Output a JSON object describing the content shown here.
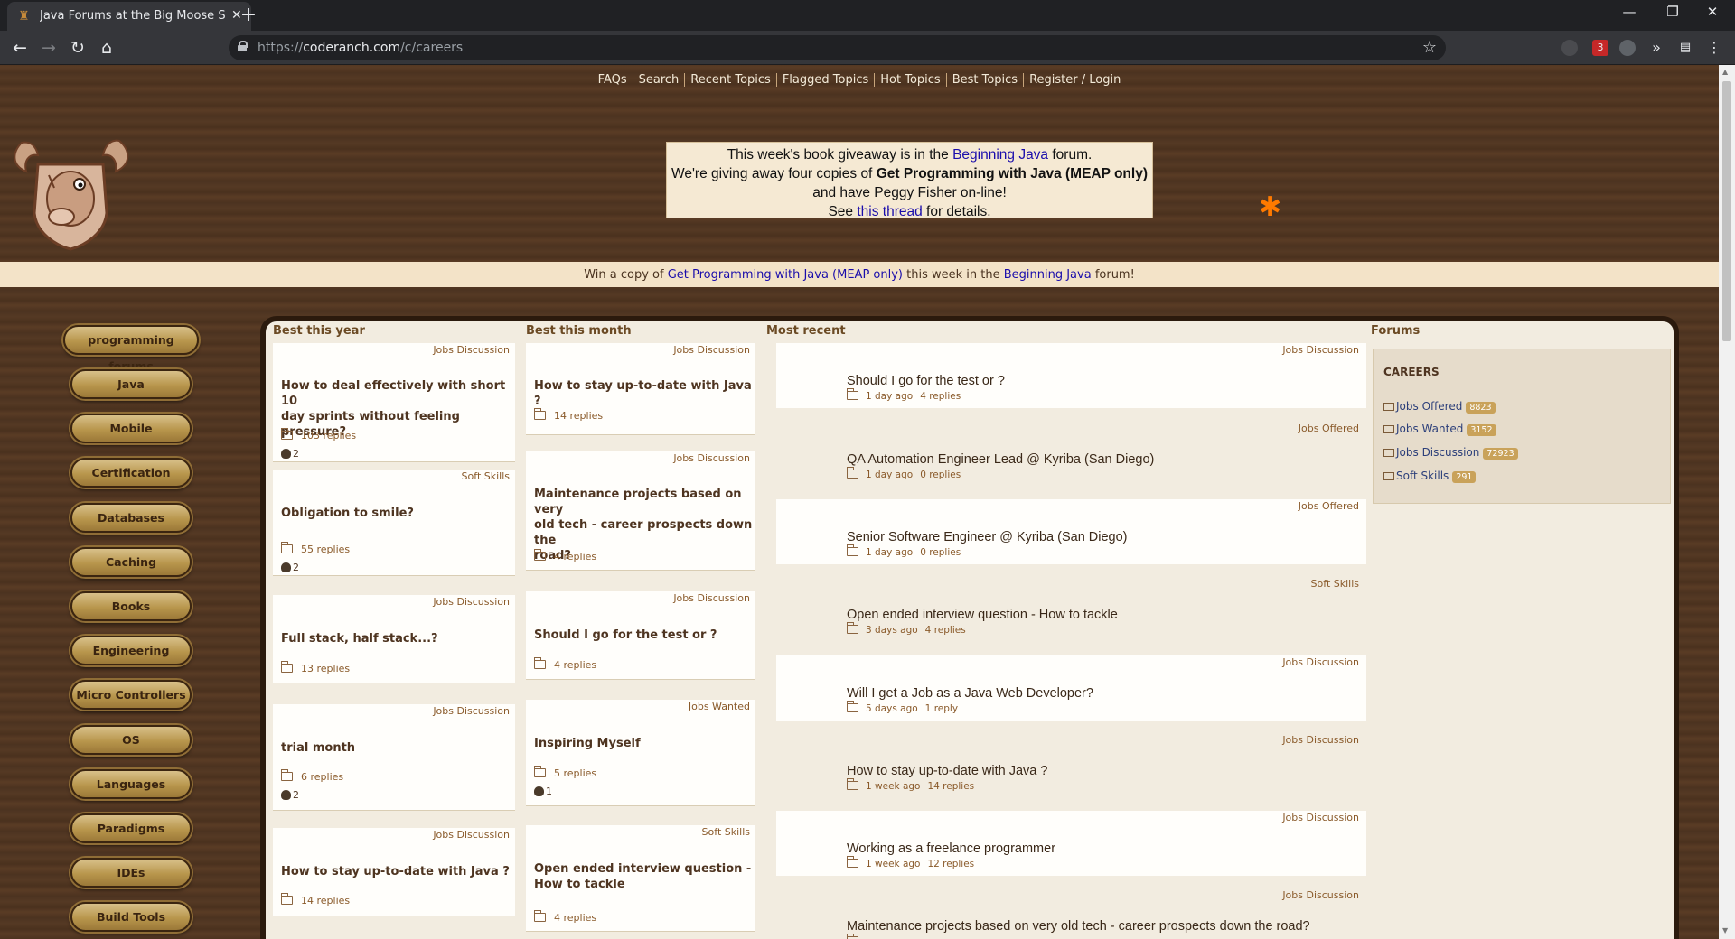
{
  "browser": {
    "tab_title": "Java Forums at the Big Moose Sal",
    "url_prefix": "https://",
    "url_host": "coderanch.com",
    "url_path": "/c/careers",
    "extension_badge": "3"
  },
  "topnav": [
    "FAQs",
    "Search",
    "Recent Topics",
    "Flagged Topics",
    "Hot Topics",
    "Best Topics",
    "Register / Login"
  ],
  "giveaway": {
    "line1_pre": "This week's book giveaway is in the ",
    "line1_link": "Beginning Java",
    "line1_post": " forum.",
    "line2_pre": "We're giving away four copies of ",
    "line2_bold": "Get Programming with Java (MEAP only)",
    "line2_post": " and have Peggy Fisher on-line!",
    "line3_pre": "See ",
    "line3_link": "this thread",
    "line3_post": " for details."
  },
  "winbar": {
    "pre": "Win a copy of ",
    "book": "Get Programming with Java (MEAP only)",
    "mid": " this week in the ",
    "forum": "Beginning Java",
    "post": " forum!"
  },
  "sidebar": [
    "programming forums",
    "Java",
    "Mobile",
    "Certification",
    "Databases",
    "Caching",
    "Books",
    "Engineering",
    "Micro Controllers",
    "OS",
    "Languages",
    "Paradigms",
    "IDEs",
    "Build Tools"
  ],
  "columns": {
    "best_year": "Best this year",
    "best_month": "Best this month",
    "most_recent": "Most recent",
    "forums": "Forums"
  },
  "best_year": [
    {
      "forum": "Jobs Discussion",
      "title_lines": [
        "How to deal effectively with short 10",
        "day sprints without feeling pressure?"
      ],
      "replies": "103 replies",
      "votes": "2"
    },
    {
      "forum": "Soft Skills",
      "title_lines": [
        "Obligation to smile?"
      ],
      "replies": "55 replies",
      "votes": "2"
    },
    {
      "forum": "Jobs Discussion",
      "title_lines": [
        "Full stack, half stack...?"
      ],
      "replies": "13 replies",
      "votes": ""
    },
    {
      "forum": "Jobs Discussion",
      "title_lines": [
        "trial month"
      ],
      "replies": "6 replies",
      "votes": "2"
    },
    {
      "forum": "Jobs Discussion",
      "title_lines": [
        "How to stay up-to-date with Java ?"
      ],
      "replies": "14 replies",
      "votes": ""
    }
  ],
  "best_month": [
    {
      "forum": "Jobs Discussion",
      "title_lines": [
        "How to stay up-to-date with Java ?"
      ],
      "replies": "14 replies",
      "votes": ""
    },
    {
      "forum": "Jobs Discussion",
      "title_lines": [
        "Maintenance projects based on very",
        "old tech - career prospects down the",
        "road?"
      ],
      "replies": "4 replies",
      "votes": ""
    },
    {
      "forum": "Jobs Discussion",
      "title_lines": [
        "Should I go for the test or ?"
      ],
      "replies": "4 replies",
      "votes": ""
    },
    {
      "forum": "Jobs Wanted",
      "title_lines": [
        "Inspiring Myself"
      ],
      "replies": "5 replies",
      "votes": "1"
    },
    {
      "forum": "Soft Skills",
      "title_lines": [
        "Open ended interview question -",
        "How to tackle"
      ],
      "replies": "4 replies",
      "votes": ""
    }
  ],
  "most_recent": [
    {
      "forum": "Jobs Discussion",
      "title": "Should I go for the test or ?",
      "age": "1 day ago",
      "replies": "4 replies"
    },
    {
      "forum": "Jobs Offered",
      "title": "QA Automation Engineer Lead @ Kyriba (San Diego)",
      "age": "1 day ago",
      "replies": "0 replies"
    },
    {
      "forum": "Jobs Offered",
      "title": "Senior Software Engineer @ Kyriba (San Diego)",
      "age": "1 day ago",
      "replies": "0 replies"
    },
    {
      "forum": "Soft Skills",
      "title": "Open ended interview question - How to tackle",
      "age": "3 days ago",
      "replies": "4 replies"
    },
    {
      "forum": "Jobs Discussion",
      "title": "Will I get a Job as a Java Web Developer?",
      "age": "5 days ago",
      "replies": "1 reply"
    },
    {
      "forum": "Jobs Discussion",
      "title": "How to stay up-to-date with Java ?",
      "age": "1 week ago",
      "replies": "14 replies"
    },
    {
      "forum": "Jobs Discussion",
      "title": "Working as a freelance programmer",
      "age": "1 week ago",
      "replies": "12 replies"
    },
    {
      "forum": "Jobs Discussion",
      "title": "Maintenance projects based on very old tech - career prospects down the road?",
      "age": "",
      "replies": ""
    }
  ],
  "forums": {
    "category": "CAREERS",
    "items": [
      {
        "name": "Jobs Offered",
        "count": "8823"
      },
      {
        "name": "Jobs Wanted",
        "count": "3152"
      },
      {
        "name": "Jobs Discussion",
        "count": "72923"
      },
      {
        "name": "Soft Skills",
        "count": "291"
      }
    ]
  }
}
